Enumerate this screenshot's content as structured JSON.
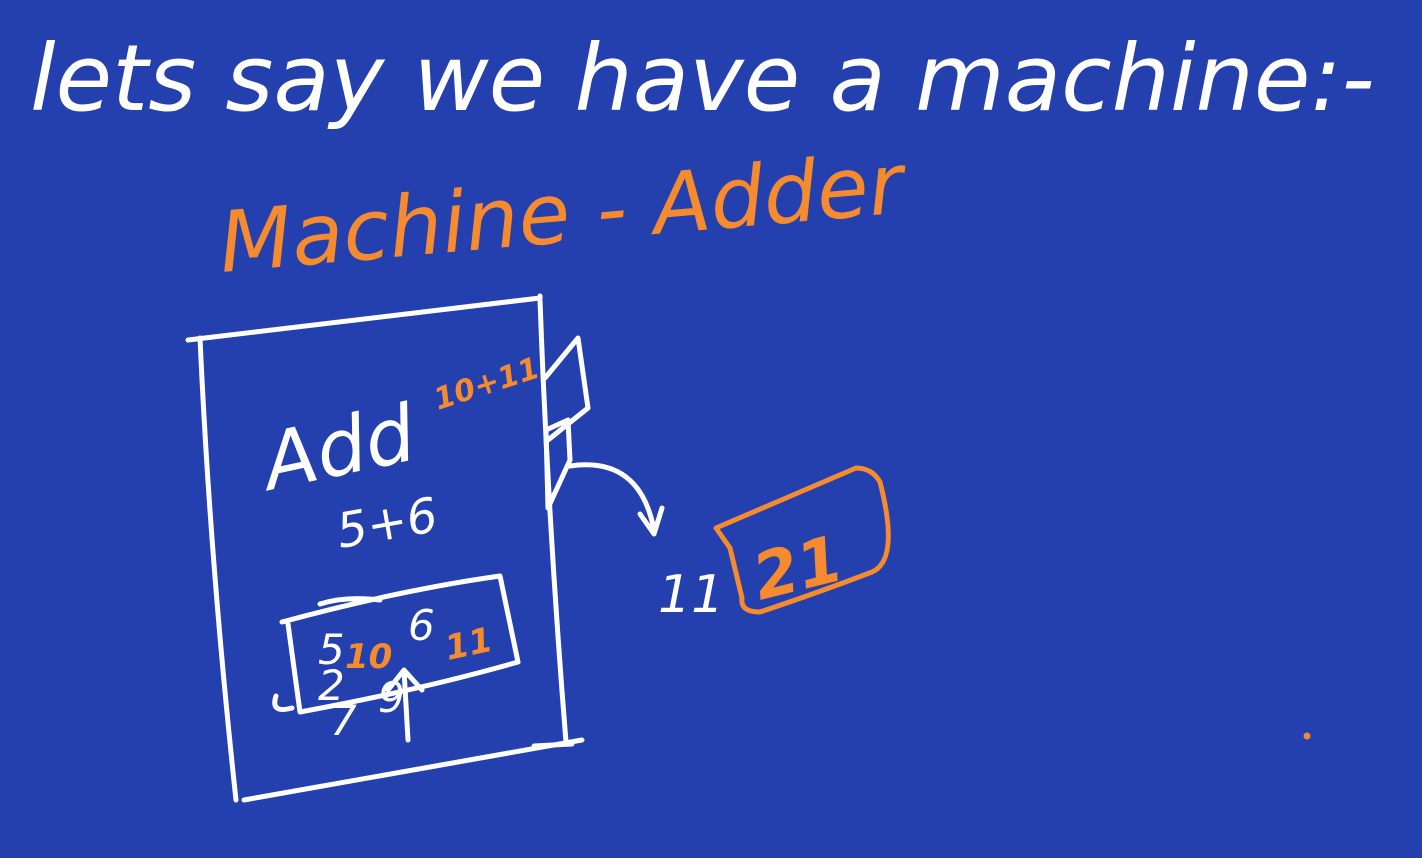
{
  "heading": "lets say we have a machine:-",
  "title": "Machine - Adder",
  "machine": {
    "label": "Add",
    "expression": "5+6",
    "note": "10+11",
    "memory": {
      "crossed_values": [
        "5",
        "2"
      ],
      "value_a": "10",
      "value_b": "6",
      "value_c": "11",
      "pointer_digits": [
        "7",
        "9"
      ]
    }
  },
  "output": {
    "old_value": "11",
    "new_value": "21"
  },
  "colors": {
    "background": "#2340ae",
    "white_ink": "#ffffff",
    "orange_ink": "#f58a2e"
  }
}
